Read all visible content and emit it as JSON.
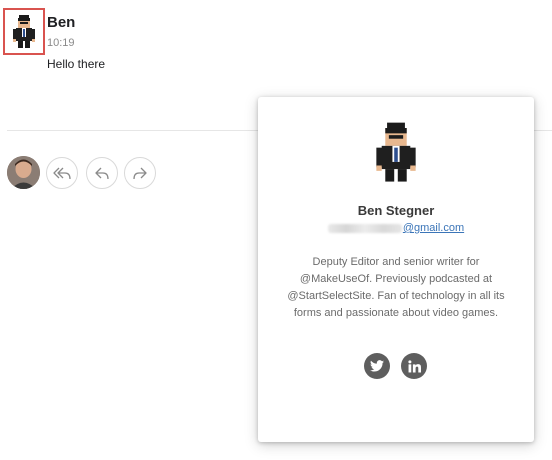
{
  "message": {
    "sender_name": "Ben",
    "time": "10:19",
    "body": "Hello there"
  },
  "icons": {
    "sender_avatar": "pixel-art-man-avatar-icon",
    "user_avatar": "user-photo-avatar",
    "reply_all": "reply-all-icon",
    "reply": "reply-icon",
    "forward": "forward-icon",
    "twitter": "twitter-icon",
    "linkedin": "linkedin-icon"
  },
  "profile_card": {
    "name": "Ben Stegner",
    "email_domain": "@gmail.com",
    "bio": "Deputy Editor and senior writer for @MakeUseOf. Previously podcasted at @StartSelectSite. Fan of technology in all its forms and passionate about video games."
  },
  "colors": {
    "highlight": "#d9534f",
    "link": "#3b75b8",
    "social_button": "#5e5e5e"
  }
}
